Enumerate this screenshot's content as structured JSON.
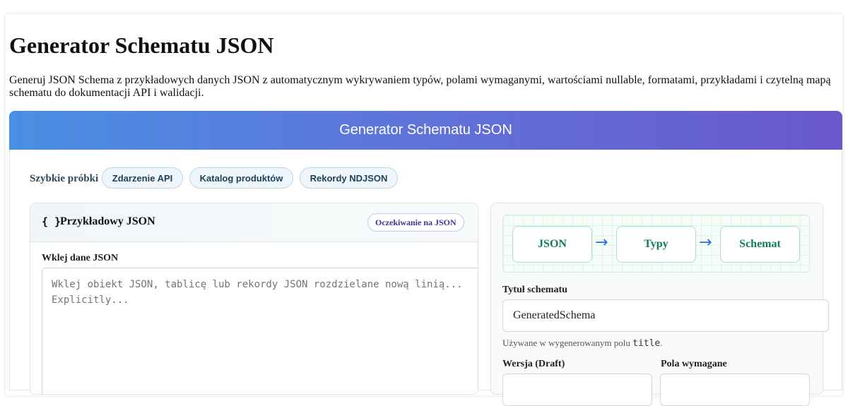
{
  "page": {
    "title": "Generator Schematu JSON",
    "intro": "Generuj JSON Schema z przykładowych danych JSON z automatycznym wykrywaniem typów, polami wymaganymi, wartościami nullable, formatami, przykładami i czytelną mapą schematu do dokumentacji API i walidacji."
  },
  "banner": {
    "title": "Generator Schematu JSON"
  },
  "samples": {
    "label": "Szybkie próbki",
    "items": [
      "Zdarzenie API",
      "Katalog produktów",
      "Rekordy NDJSON"
    ]
  },
  "input_card": {
    "icon": "{ }",
    "title": "Przykładowy JSON",
    "status": "Oczekiwanie na JSON",
    "field_label": "Wklej dane JSON",
    "placeholder": "Wklej obiekt JSON, tablicę lub rekordy JSON rozdzielane nową linią... Explicitly..."
  },
  "options_card": {
    "flow": [
      "JSON",
      "Typy",
      "Schemat"
    ],
    "flow_arrow": "→",
    "schema_title_label": "Tytuł schematu",
    "schema_title_value": "GeneratedSchema",
    "help_prefix": "Używane w wygenerowanym polu ",
    "help_code": "title",
    "help_suffix": ".",
    "draft_label": "Wersja (Draft)",
    "required_label": "Pola wymagane"
  },
  "colors": {
    "banner_start": "#4a8fe3",
    "banner_end": "#6a57cc",
    "flow_text": "#127a5e",
    "arrow": "#2a6fd6"
  }
}
